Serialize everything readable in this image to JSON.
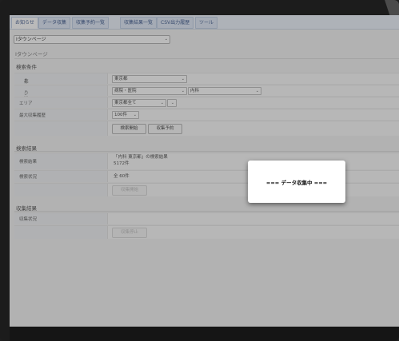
{
  "tabs": [
    "お知らせ",
    "データ収集",
    "収集予約一覧",
    "収集結果一覧",
    "CSV出力履歴",
    "ツール"
  ],
  "page_select": {
    "value": "Iタウンページ"
  },
  "page_title": "Iタウンページ",
  "search_conditions": {
    "title": "検索条件",
    "prefecture": {
      "label": "都道府県",
      "required_mark": "*",
      "value": "東京都"
    },
    "genre": {
      "label": "ジャンル",
      "required_mark": "*",
      "value1": "病院・医院",
      "value2": "内科"
    },
    "area": {
      "label": "エリア",
      "value": "東京都全て"
    },
    "max_count": {
      "label": "最大収集履歴",
      "value": "100件"
    },
    "search_button": "検索開始",
    "reserve_button": "収集予約"
  },
  "search_results": {
    "title": "検索結果",
    "result_label": "検索結果",
    "result_line1": "「内科 東京都」の検索結果",
    "result_line2": "5172件",
    "status_label": "検索状況",
    "status_value": "全 60件",
    "collect_button": "収集開始"
  },
  "collection_results": {
    "title": "収集結果",
    "status_label": "収集状況",
    "stop_button": "収集停止"
  },
  "modal": {
    "text": "=== データ収集中 ==="
  }
}
